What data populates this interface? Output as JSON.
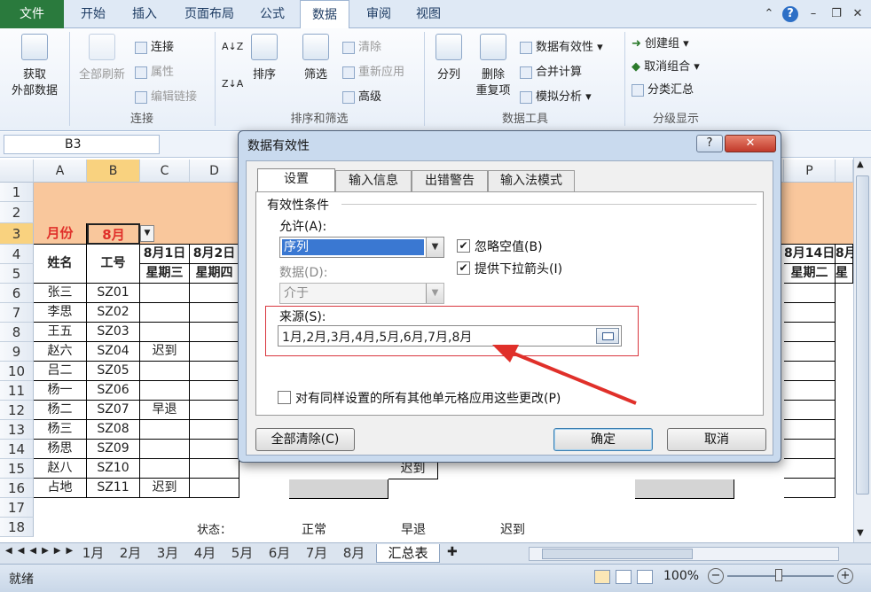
{
  "ribbon_tabs": [
    "文件",
    "开始",
    "插入",
    "页面布局",
    "公式",
    "数据",
    "审阅",
    "视图"
  ],
  "active_tab": "数据",
  "ribbon": {
    "get_external_1": "获取",
    "get_external_2": "外部数据",
    "refresh_all": "全部刷新",
    "connections": "连接",
    "properties": "属性",
    "edit_links": "编辑链接",
    "group_connections": "连接",
    "sort": "排序",
    "filter": "筛选",
    "clear": "清除",
    "reapply": "重新应用",
    "advanced": "高级",
    "group_sort_filter": "排序和筛选",
    "text_to_columns": "分列",
    "remove_dup_1": "删除",
    "remove_dup_2": "重复项",
    "data_validation": "数据有效性",
    "consolidate": "合并计算",
    "whatif": "模拟分析",
    "group_data_tools": "数据工具",
    "group": "创建组",
    "ungroup": "取消组合",
    "subtotal": "分类汇总",
    "group_outline": "分级显示"
  },
  "name_box": "B3",
  "columns": [
    "A",
    "B",
    "C",
    "D",
    "P"
  ],
  "rows": [
    "1",
    "2",
    "3",
    "4",
    "5",
    "6",
    "7",
    "8",
    "9",
    "10",
    "11",
    "12",
    "13",
    "14",
    "15",
    "16",
    "17",
    "18"
  ],
  "sheet": {
    "month_label": "月份",
    "month_value": "8月",
    "header_name": "姓名",
    "header_id": "工号",
    "date1": "8月1日",
    "date2": "8月2日",
    "day1": "星期三",
    "day2": "星期四",
    "date14": "8月14日",
    "day14": "星期二",
    "date15": "8月",
    "day15": "星",
    "status_label": "状态：",
    "status_normal": "正常",
    "status_leave": "早退",
    "status_late": "迟到",
    "r15_col_h": "迟到",
    "employees": [
      {
        "name": "张三",
        "id": "SZ01",
        "c": ""
      },
      {
        "name": "李思",
        "id": "SZ02",
        "c": ""
      },
      {
        "name": "王五",
        "id": "SZ03",
        "c": ""
      },
      {
        "name": "赵六",
        "id": "SZ04",
        "c": "迟到"
      },
      {
        "name": "吕二",
        "id": "SZ05",
        "c": ""
      },
      {
        "name": "杨一",
        "id": "SZ06",
        "c": ""
      },
      {
        "name": "杨二",
        "id": "SZ07",
        "c": "早退"
      },
      {
        "name": "杨三",
        "id": "SZ08",
        "c": ""
      },
      {
        "name": "杨思",
        "id": "SZ09",
        "c": ""
      },
      {
        "name": "赵八",
        "id": "SZ10",
        "c": ""
      },
      {
        "name": "占地",
        "id": "SZ11",
        "c": "迟到"
      }
    ]
  },
  "sheet_tabs": [
    "1月",
    "2月",
    "3月",
    "4月",
    "5月",
    "6月",
    "7月",
    "8月",
    "汇总表"
  ],
  "active_sheet": "汇总表",
  "status": {
    "ready": "就绪",
    "zoom": "100%"
  },
  "dialog": {
    "title": "数据有效性",
    "tabs": [
      "设置",
      "输入信息",
      "出错警告",
      "输入法模式"
    ],
    "section": "有效性条件",
    "allow_label": "允许(A):",
    "allow_value": "序列",
    "ignore_blank": "忽略空值(B)",
    "dropdown_arrow": "提供下拉箭头(I)",
    "data_label": "数据(D):",
    "data_value": "介于",
    "source_label": "来源(S):",
    "source_value": "1月,2月,3月,4月,5月,6月,7月,8月",
    "apply_all": "对有同样设置的所有其他单元格应用这些更改(P)",
    "clear_all": "全部清除(C)",
    "ok": "确定",
    "cancel": "取消"
  },
  "colors": {
    "accent_red": "#e0302a",
    "header_orange": "#f9c79c",
    "file_green": "#2a7a3d"
  }
}
